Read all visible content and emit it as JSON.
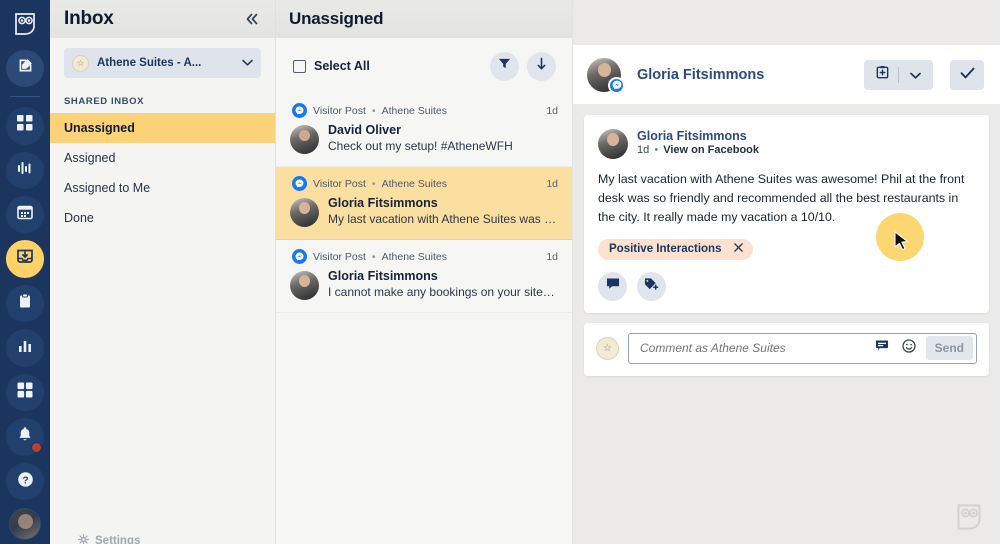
{
  "rail": {
    "logo": "hootsuite-owl-logo",
    "items": [
      {
        "icon": "compose-pencil-icon",
        "name": "compose"
      },
      {
        "icon": "grid-dashboard-icon",
        "name": "streams"
      },
      {
        "icon": "analytics-bars-icon",
        "name": "analytics"
      },
      {
        "icon": "calendar-icon",
        "name": "planner"
      },
      {
        "icon": "inbox-tray-icon",
        "name": "inbox"
      },
      {
        "icon": "clipboard-icon",
        "name": "content"
      },
      {
        "icon": "chart-bars-icon",
        "name": "reports"
      },
      {
        "icon": "apps-grid-icon",
        "name": "apps"
      },
      {
        "icon": "bell-icon",
        "name": "notifications"
      },
      {
        "icon": "question-mark-icon",
        "name": "help"
      }
    ]
  },
  "sidebar": {
    "title": "Inbox",
    "collapse_icon": "chevron-double-left-icon",
    "account": {
      "name": "Athene Suites - A...",
      "caret_icon": "chevron-down-icon",
      "avatar_icon": "account-avatar"
    },
    "section_label": "SHARED INBOX",
    "items": [
      {
        "label": "Unassigned",
        "selected": true
      },
      {
        "label": "Assigned",
        "selected": false
      },
      {
        "label": "Assigned to Me",
        "selected": false
      },
      {
        "label": "Done",
        "selected": false
      }
    ],
    "footer": {
      "label": "Settings",
      "icon": "gear-icon"
    }
  },
  "list": {
    "header_title": "Unassigned",
    "select_all_label": "Select All",
    "filter_icon": "funnel-filter-icon",
    "sort_icon": "arrow-down-sort-icon",
    "conversations": [
      {
        "source": "Visitor Post",
        "separator": "•",
        "page": "Athene Suites",
        "time": "1d",
        "name": "David Oliver",
        "preview": "Check out my setup! #AtheneWFH",
        "selected": false,
        "network_icon": "facebook-messenger-icon"
      },
      {
        "source": "Visitor Post",
        "separator": "•",
        "page": "Athene Suites",
        "time": "1d",
        "name": "Gloria Fitsimmons",
        "preview": "My last vacation with Athene Suites was awes…",
        "selected": true,
        "network_icon": "facebook-messenger-icon"
      },
      {
        "source": "Visitor Post",
        "separator": "•",
        "page": "Athene Suites",
        "time": "1d",
        "name": "Gloria Fitsimmons",
        "preview": "I cannot make any bookings on your site. I thi…",
        "selected": false,
        "network_icon": "facebook-messenger-icon"
      }
    ]
  },
  "detail": {
    "header": {
      "name": "Gloria Fitsimmons",
      "network_icon": "facebook-messenger-icon",
      "assign_icon": "assign-to-icon",
      "assign_caret_icon": "chevron-down-icon",
      "done_icon": "checkmark-icon"
    },
    "post": {
      "author": "Gloria Fitsimmons",
      "time": "1d",
      "separator": "•",
      "link_label": "View on Facebook",
      "text": "My last vacation with Athene Suites was awesome! Phil at the front desk was so friendly and recommended all the best restaurants  in the city. It really made my vacation a 10/10.",
      "tag": {
        "label": "Positive Interactions",
        "remove_icon": "close-x-icon"
      },
      "actions": [
        {
          "icon": "comment-reply-icon",
          "name": "reply"
        },
        {
          "icon": "add-tag-icon",
          "name": "add-tag"
        }
      ]
    },
    "compose": {
      "placeholder": "Comment as Athene Suites",
      "gif_icon": "comment-box-icon",
      "emoji_icon": "emoji-smiley-icon",
      "send_label": "Send",
      "avatar_icon": "brand-avatar"
    }
  },
  "overlay": {
    "cursor_icon": "mouse-pointer-icon",
    "highlight_color": "#fcd670",
    "watermark_icon": "hootsuite-owl-watermark"
  },
  "colors": {
    "rail_bg": "#1c355e",
    "selected_nav": "#fbd277",
    "selected_conv": "#fbdfa0",
    "tag_bg": "#fbe2d0",
    "facebook_blue": "#1877f2",
    "link_blue": "#2c4a86"
  }
}
